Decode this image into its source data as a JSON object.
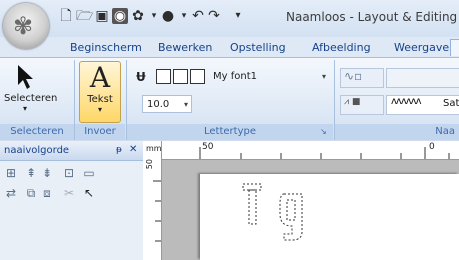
{
  "window": {
    "title": "Naamloos - Layout & Editing"
  },
  "quick_access": [
    "new-icon",
    "open-icon",
    "save-icon",
    "hoop-icon",
    "gear-icon",
    "circle-icon",
    "undo-icon",
    "redo-icon",
    "customize-icon"
  ],
  "tabs": [
    "Beginscherm",
    "Bewerken",
    "Opstelling",
    "Afbeelding",
    "Weergave"
  ],
  "ribbon": {
    "select": {
      "label": "Selecteren",
      "group": "Selecteren"
    },
    "text": {
      "glyph": "A",
      "label": "Tekst",
      "group": "Invoer"
    },
    "font": {
      "name": "My font1",
      "size": "10.0",
      "group": "Lettertype"
    },
    "stitch": {
      "satin_label": "Sat",
      "group": "Naa"
    }
  },
  "pane": {
    "title": "naaivolgorde",
    "pin": "ᵽ",
    "close": "✕"
  },
  "rulers": {
    "unit": "mm",
    "top_labels": [
      "50",
      "0"
    ],
    "left_labels": [
      "50"
    ]
  },
  "canvas": {
    "sample_text": "Tg"
  },
  "colors": {
    "ribbon_bg": "#dce7f5",
    "tab_text": "#15428b",
    "group_label": "#3e6aaa",
    "canvas_bg": "#bbbbbb"
  }
}
